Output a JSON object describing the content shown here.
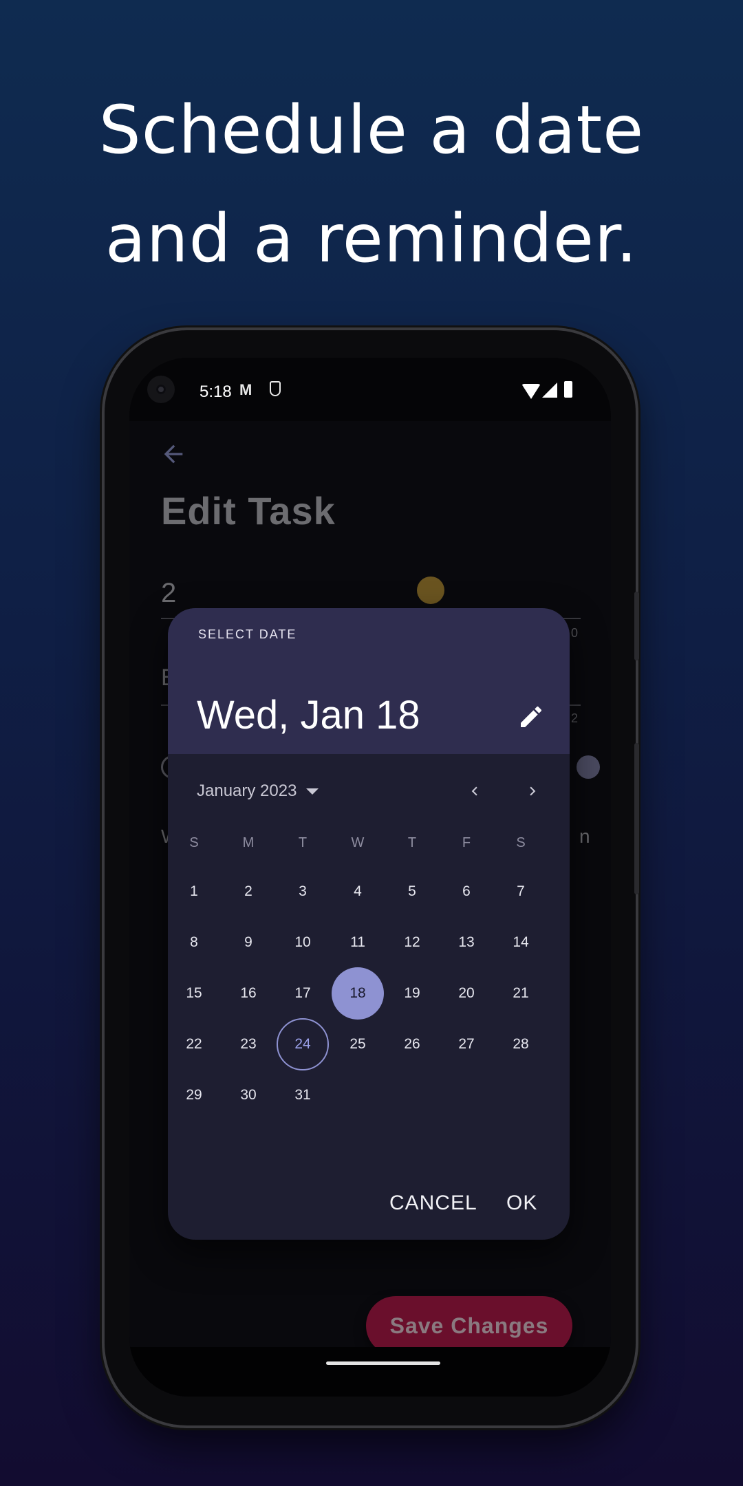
{
  "headline": {
    "line1": "Schedule a date",
    "line2": "and a reminder."
  },
  "status_bar": {
    "time": "5:18",
    "icons": [
      "gmail-icon",
      "shield-icon",
      "wifi-icon",
      "signal-icon",
      "battery-icon"
    ]
  },
  "app": {
    "back_icon": "arrow-back-icon",
    "title": "Edit Task",
    "field1_fragment": "2",
    "field2_fragment": "E",
    "row_fragment": "W",
    "row_fragment_right": "n",
    "counter1": "0",
    "counter2": "2",
    "save_button": "Save Changes"
  },
  "date_picker": {
    "label": "SELECT DATE",
    "selected_date_text": "Wed, Jan 18",
    "month_label": "January 2023",
    "weekdays": [
      "S",
      "M",
      "T",
      "W",
      "T",
      "F",
      "S"
    ],
    "days": [
      "1",
      "2",
      "3",
      "4",
      "5",
      "6",
      "7",
      "8",
      "9",
      "10",
      "11",
      "12",
      "13",
      "14",
      "15",
      "16",
      "17",
      "18",
      "19",
      "20",
      "21",
      "22",
      "23",
      "24",
      "25",
      "26",
      "27",
      "28",
      "29",
      "30",
      "31"
    ],
    "first_weekday_index": 0,
    "selected_day": 18,
    "today_day": 24,
    "cancel": "CANCEL",
    "ok": "OK"
  },
  "colors": {
    "accent": "#8e92d2",
    "dialog_bg": "#1e1e31",
    "header_bg": "#2f2d4f",
    "save_button": "#6a0f2c"
  }
}
